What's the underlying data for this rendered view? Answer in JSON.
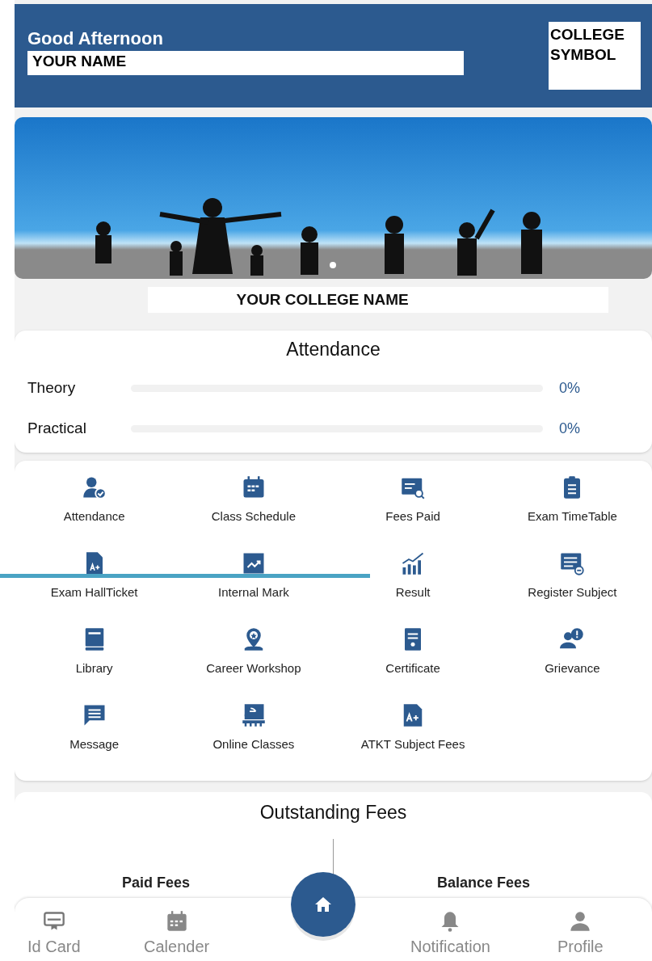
{
  "header": {
    "greeting": "Good Afternoon",
    "name": "YOUR NAME",
    "logo_text": "COLLEGE SYMBOL"
  },
  "college_name": "YOUR COLLEGE NAME",
  "attendance": {
    "title": "Attendance",
    "rows": [
      {
        "label": "Theory",
        "level": 0,
        "reading": "0%"
      },
      {
        "label": "Practical",
        "level": 0,
        "reading": "0%"
      }
    ]
  },
  "menu": [
    {
      "label": "Attendance"
    },
    {
      "label": "Class Schedule"
    },
    {
      "label": "Fees Paid"
    },
    {
      "label": "Exam TimeTable"
    },
    {
      "label": "Exam HallTicket"
    },
    {
      "label": "Internal Mark"
    },
    {
      "label": "Result"
    },
    {
      "label": "Register Subject"
    },
    {
      "label": "Library"
    },
    {
      "label": "Career Workshop"
    },
    {
      "label": "Certificate"
    },
    {
      "label": "Grievance"
    },
    {
      "label": "Message"
    },
    {
      "label": "Online Classes"
    },
    {
      "label": "ATKT Subject Fees"
    }
  ],
  "outstanding_fees": {
    "title": "Outstanding Fees",
    "paid_label": "Paid Fees",
    "balance_label": "Balance Fees"
  },
  "bottom_nav": [
    {
      "label": "Id Card"
    },
    {
      "label": "Calender"
    },
    {
      "label": "Notification"
    },
    {
      "label": "Profile"
    }
  ]
}
